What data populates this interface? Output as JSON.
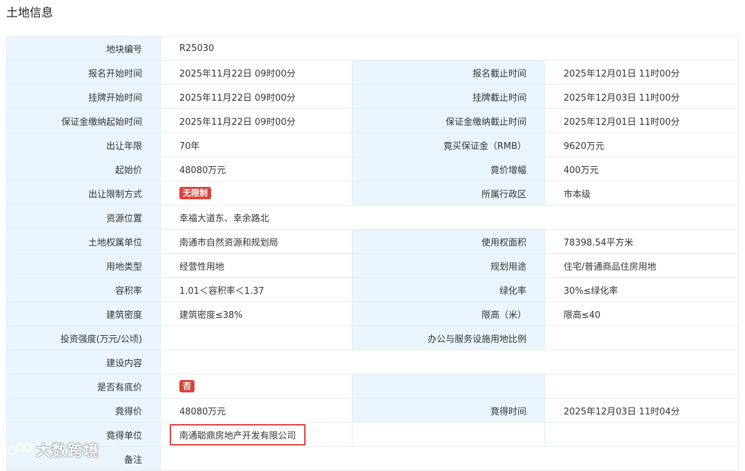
{
  "page": {
    "title": "土地信息"
  },
  "rows": {
    "parcel_no": {
      "label": "地块编号",
      "value": "R25030"
    },
    "reg": {
      "start_label": "报名开始时间",
      "start": "2025年11月22日 09时00分",
      "end_label": "报名截止时间",
      "end": "2025年12月01日 11时00分"
    },
    "listing": {
      "start_label": "挂牌开始时间",
      "start": "2025年11月22日 09时00分",
      "end_label": "挂牌截止时间",
      "end": "2025年12月03日 11时00分"
    },
    "deposit_pay": {
      "start_label": "保证金缴纳起始时间",
      "start": "2025年11月22日 09时00分",
      "end_label": "保证金缴纳截止时间",
      "end": "2025年12月01日 11时00分"
    },
    "term": {
      "label": "出让年限",
      "value": "70年",
      "deposit_label": "竟买保证金（RMB）",
      "deposit": "9620万元"
    },
    "price": {
      "label": "起始价",
      "value": "48080万元",
      "increment_label": "竟价增幅",
      "increment": "400万元"
    },
    "restriction": {
      "label": "出让限制方式",
      "tag": "无限制",
      "district_label": "所属行政区",
      "district": "市本级"
    },
    "location": {
      "label": "资源位置",
      "value": "幸福大道东、幸余路北"
    },
    "owner": {
      "label": "土地权属单位",
      "value": "南通市自然资源和规划局",
      "area_label": "使用权面积",
      "area": "78398.54平方米"
    },
    "land_type": {
      "label": "用地类型",
      "value": "经营性用地",
      "use_label": "规划用途",
      "use": "住宅/普通商品住房用地"
    },
    "far": {
      "label": "容积率",
      "value": "1.01＜容积率＜1.37",
      "green_label": "绿化率",
      "green": "30%≤绿化率"
    },
    "density": {
      "label": "建筑密度",
      "value": "建筑密度≤38%",
      "height_label": "限高（米）",
      "height": "限高≤40"
    },
    "investment": {
      "label": "投资强度(万元/公顷)",
      "value": "",
      "office_label": "办公与服务设施用地比例",
      "office": ""
    },
    "construction": {
      "label": "建设内容",
      "value": ""
    },
    "reserve": {
      "label": "是否有底价",
      "tag": "否"
    },
    "win_price": {
      "label": "竟得价",
      "value": "48080万元",
      "time_label": "竟得时间",
      "time": "2025年12月03日 11时04分"
    },
    "winner": {
      "label": "竟得单位",
      "value": "南通聪鼎房地产开发有限公司"
    },
    "remark": {
      "label": "备注",
      "value": ""
    }
  },
  "watermark": {
    "text": "大数跨境"
  },
  "colors": {
    "label_bg": "#eaf4fd",
    "tag_red": "#d9443a",
    "highlight_border": "#e0403a"
  }
}
